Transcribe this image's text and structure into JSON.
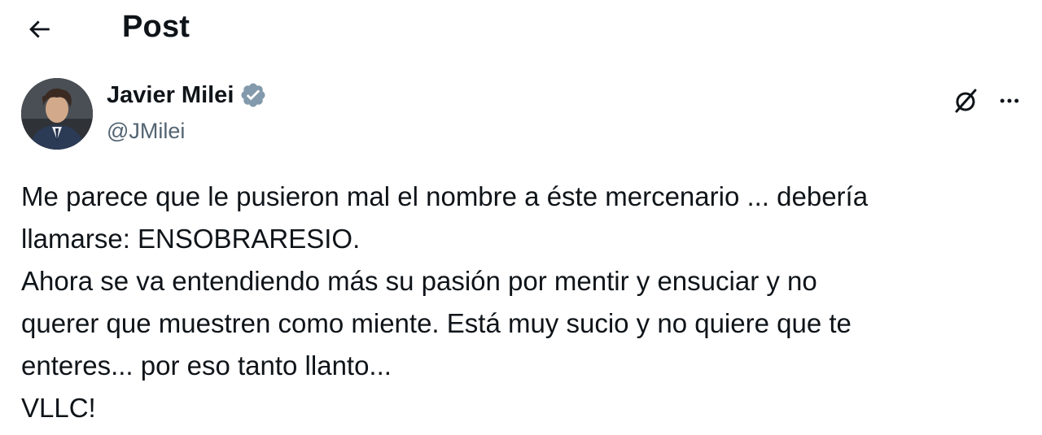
{
  "header": {
    "title": "Post",
    "back_icon": "arrow-left-icon"
  },
  "author": {
    "display_name": "Javier Milei",
    "handle": "@JMilei",
    "verified": true,
    "verified_icon": "verified-badge-icon",
    "verified_color": "#829aab",
    "avatar": "avatar-photo"
  },
  "actions": {
    "grok_icon": "grok-icon",
    "more_icon": "more-horizontal-icon"
  },
  "tweet": {
    "lines": [
      "Me parece que le pusieron mal el nombre a éste mercenario ... debería",
      "llamarse: ENSOBRARESIO.",
      "Ahora se va entendiendo más su pasión por mentir y ensuciar y no",
      "querer que muestren como miente. Está muy sucio y no quiere que te",
      "enteres... por eso tanto llanto...",
      "VLLC!"
    ]
  },
  "colors": {
    "text_primary": "#0f1419",
    "text_secondary": "#536471",
    "background": "#ffffff"
  }
}
